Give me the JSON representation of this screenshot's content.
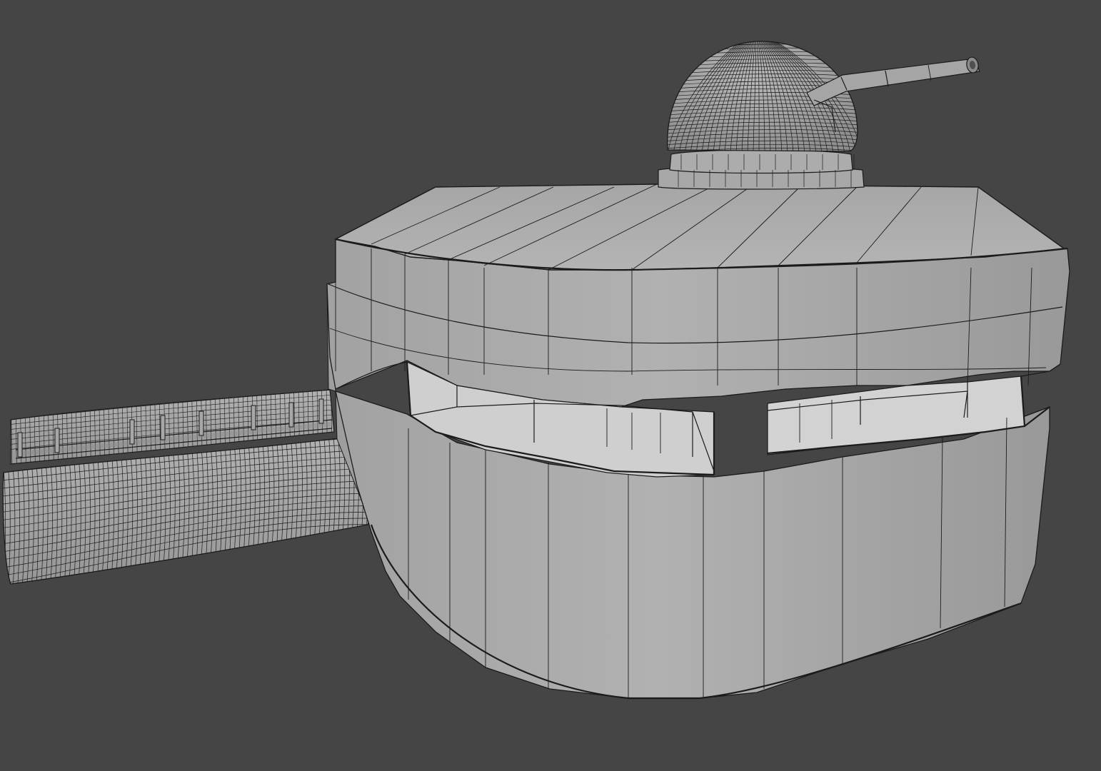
{
  "viewport": {
    "background": "#454545",
    "shading": "solid-wireframe",
    "surface_color": "#a9a9a9",
    "wire_color": "#1b1b1b"
  },
  "objects": [
    {
      "name": "bunker-body"
    },
    {
      "name": "gun-turret-dome"
    },
    {
      "name": "gun-barrel"
    },
    {
      "name": "tunnel-passage"
    }
  ]
}
